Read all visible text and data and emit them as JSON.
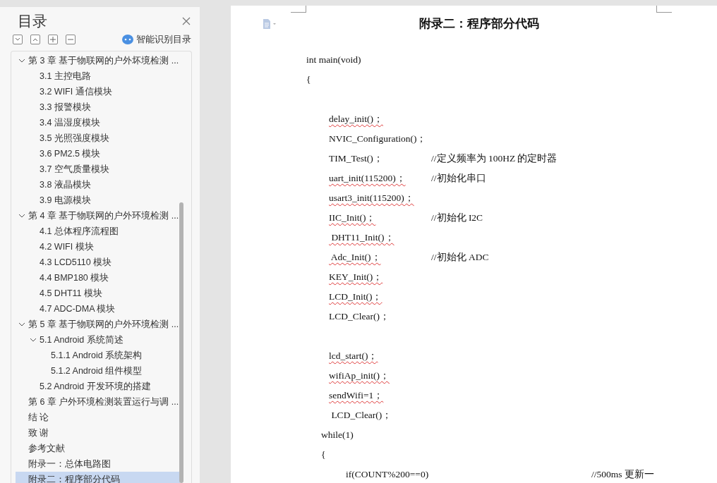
{
  "toc_panel": {
    "title": "目录",
    "smart_toc_label": "智能识别目录",
    "items": [
      {
        "label": "第 3 章  基于物联网的户外坏境检测 ...",
        "selected": false,
        "expanded": true,
        "children": [
          {
            "label": "3.1  主控电路",
            "selected": false
          },
          {
            "label": "3.2 WIFI 通信模块",
            "selected": false
          },
          {
            "label": "3.3 报警模块",
            "selected": false
          },
          {
            "label": "3.4 温湿度模块",
            "selected": false
          },
          {
            "label": "3.5  光照强度模块",
            "selected": false
          },
          {
            "label": "3.6 PM2.5 模块",
            "selected": false
          },
          {
            "label": "3.7  空气质量模块",
            "selected": false
          },
          {
            "label": "3.8 液晶模块",
            "selected": false
          },
          {
            "label": "3.9 电源模块",
            "selected": false
          }
        ]
      },
      {
        "label": "第 4 章  基于物联网的户外环境检测 ...",
        "selected": false,
        "expanded": true,
        "children": [
          {
            "label": "4.1  总体程序流程图",
            "selected": false
          },
          {
            "label": "4.2 WIFI 模块",
            "selected": false
          },
          {
            "label": "4.3 LCD5110 模块",
            "selected": false
          },
          {
            "label": "4.4 BMP180 模块",
            "selected": false
          },
          {
            "label": "4.5 DHT11 模块",
            "selected": false
          },
          {
            "label": "4.7 ADC-DMA 模块",
            "selected": false
          }
        ]
      },
      {
        "label": "第 5 章  基于物联网的户外环境检测 ...",
        "selected": false,
        "expanded": true,
        "children": [
          {
            "label": "5.1 Android 系统简述",
            "selected": false,
            "expanded": true,
            "children": [
              {
                "label": "5.1.1 Android 系统架构",
                "selected": false
              },
              {
                "label": "5.1.2 Android 组件模型",
                "selected": false
              }
            ]
          },
          {
            "label": "5.2 Android 开发环境的搭建",
            "selected": false
          }
        ]
      },
      {
        "label": "第 6 章  户外环境检测装置运行与调 ...",
        "selected": false
      },
      {
        "label": "结    论",
        "selected": false
      },
      {
        "label": "致    谢",
        "selected": false
      },
      {
        "label": "参考文献",
        "selected": false
      },
      {
        "label": "附录一：总体电路图",
        "selected": false
      },
      {
        "label": "附录二：程序部分代码",
        "selected": true
      }
    ]
  },
  "document": {
    "heading": "附录二：程序部分代码",
    "lines": [
      {
        "kind": "top",
        "code": "int main(void)",
        "spell_marked": false
      },
      {
        "kind": "top",
        "code": "{",
        "spell_marked": false
      },
      {
        "kind": "blank"
      },
      {
        "kind": "body",
        "code": "delay_init()；",
        "spell_marked": true
      },
      {
        "kind": "body",
        "code": "NVIC_Configuration()；",
        "spell_marked": false
      },
      {
        "kind": "body",
        "code": "TIM_Test()；",
        "comment": "//定义频率为 100HZ 的定时器",
        "spell_marked": false
      },
      {
        "kind": "body",
        "code": "uart_init(115200)；",
        "comment": "//初始化串口",
        "spell_marked": true
      },
      {
        "kind": "body",
        "code": "usart3_init(115200)；",
        "spell_marked": true
      },
      {
        "kind": "body",
        "code": "IIC_Init()；",
        "comment": "//初始化 I2C",
        "spell_marked": true
      },
      {
        "kind": "body",
        "code": " DHT11_Init()；",
        "spell_marked": true
      },
      {
        "kind": "body",
        "code": " Adc_Init()；",
        "comment": "//初始化 ADC",
        "spell_marked": true
      },
      {
        "kind": "body",
        "code": "KEY_Init()；",
        "spell_marked": true
      },
      {
        "kind": "body",
        "code": "LCD_Init()；",
        "spell_marked": true
      },
      {
        "kind": "body",
        "code": "LCD_Clear()；",
        "spell_marked": false
      },
      {
        "kind": "blank"
      },
      {
        "kind": "body",
        "code": "lcd_start()；",
        "spell_marked": true
      },
      {
        "kind": "body",
        "code": "wifiAp_init()；",
        "spell_marked": true
      },
      {
        "kind": "body",
        "code": "sendWifi=1；",
        "spell_marked": true
      },
      {
        "kind": "body",
        "code": " LCD_Clear()；",
        "spell_marked": false
      },
      {
        "kind": "loop",
        "code": "while(1)",
        "spell_marked": false
      },
      {
        "kind": "loop",
        "code": "{",
        "spell_marked": false
      },
      {
        "kind": "inner",
        "code": "if(COUNT%200==0)",
        "comment": "//500ms 更新一",
        "spell_marked": false
      }
    ]
  }
}
